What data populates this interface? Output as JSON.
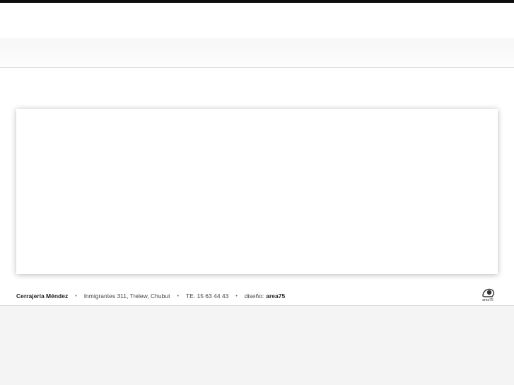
{
  "footer": {
    "company": "Cerrajería Méndez",
    "address": "Inmigrantes 311, Trelew, Chubut",
    "phone": "TE. 15 63 44 43",
    "design_label": "diseño:",
    "design_brand": "area75",
    "separator": "•"
  },
  "logo": {
    "icon": "area75-logo-icon",
    "text": "area75"
  },
  "colors": {
    "top_bar": "#0d0d0d",
    "background": "#f4f4f4",
    "panel": "#ffffff",
    "footer_text": "#444444"
  }
}
